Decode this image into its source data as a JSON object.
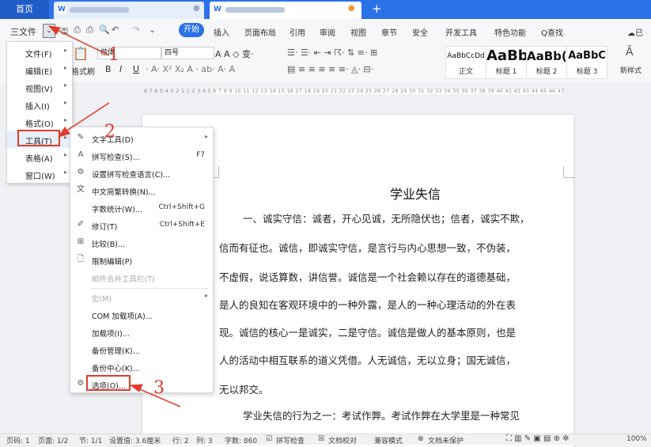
{
  "tabs": {
    "home": "首页",
    "new_tab": "+"
  },
  "menubar": {
    "file_menu": "三文件",
    "start_label": "开始",
    "items": [
      "插入",
      "页面布局",
      "引用",
      "审阅",
      "视图",
      "章节",
      "安全",
      "开发工具",
      "特色功能"
    ],
    "search": "Q查找"
  },
  "ribbon": {
    "format_painter": "格式刷",
    "font_name": "楷体",
    "font_size": "四号",
    "bold": "B",
    "italic": "I",
    "underline": "U",
    "styles": [
      {
        "preview": "AaBbCcDd",
        "name": "正文"
      },
      {
        "preview": "AaBb",
        "name": "标题 1"
      },
      {
        "preview": "AaBb(",
        "name": "标题 2"
      },
      {
        "preview": "AaBbC",
        "name": "标题 3"
      }
    ],
    "new_style": "新样式",
    "ruler_numbers": "8 7 6 5 4 3 2 1   1 2 3 4 5 6 7 8 9 10 11 12 13 14 15 16 17 18 19 20 21 22 23 24 25 26 27 28 29 30 31 32 33 34 35 36 37 38 39 40 41 42 43 44 45 46 47"
  },
  "main_menu": [
    {
      "label": "文件(F)"
    },
    {
      "label": "编辑(E)"
    },
    {
      "label": "视图(V)"
    },
    {
      "label": "插入(I)"
    },
    {
      "label": "格式(O)"
    },
    {
      "label": "工具(T)"
    },
    {
      "label": "表格(A)"
    },
    {
      "label": "窗口(W)"
    }
  ],
  "tools_submenu": [
    {
      "label": "文字工具(D)",
      "shortcut": "",
      "arrow": true,
      "icon": "✎"
    },
    {
      "label": "拼写检查(S)...",
      "shortcut": "F7",
      "icon": "A"
    },
    {
      "label": "设置拼写检查语言(C)...",
      "shortcut": "",
      "icon": "⚙"
    },
    {
      "label": "中文简繁转换(N)...",
      "shortcut": "",
      "icon": "文"
    },
    {
      "label": "字数统计(W)...",
      "shortcut": "Ctrl+Shift+G",
      "icon": ""
    },
    {
      "label": "修订(T)",
      "shortcut": "Ctrl+Shift+E",
      "icon": "✐"
    },
    {
      "label": "比较(B)...",
      "shortcut": "",
      "icon": "⊞"
    },
    {
      "label": "限制编辑(P)",
      "shortcut": "",
      "icon": "🗋"
    },
    {
      "label": "邮件合并工具栏(T)",
      "shortcut": "",
      "disabled": true,
      "icon": ""
    },
    {
      "label": "宏(M)",
      "shortcut": "",
      "arrow": true,
      "disabled": true,
      "icon": ""
    },
    {
      "label": "COM 加载项(A)...",
      "shortcut": "",
      "icon": ""
    },
    {
      "label": "加载项(I)...",
      "shortcut": "",
      "icon": ""
    },
    {
      "label": "备份管理(K)...",
      "shortcut": "",
      "icon": ""
    },
    {
      "label": "备份中心(K)...",
      "shortcut": "",
      "icon": ""
    },
    {
      "label": "选项(O)...",
      "shortcut": "",
      "icon": "⚙"
    }
  ],
  "document": {
    "title": "学业失信",
    "paragraphs": [
      "一、诚实守信：诚者，开心见诚，无所隐伏也；信者，诚实不欺，",
      "信而有征也。诚信，即诚实守信，是言行与内心思想一致，不伪装，",
      "不虚假，说话算数，讲信誉。诚信是一个社会赖以存在的道德基础，",
      "是人的良知在客观环境中的一种外露，是人的一种心理活动的外在表",
      "现。诚信的核心一是诚实，二是守信。诚信是做人的基本原则，也是",
      "人的活动中相互联系的道义凭借。人无诚信，无以立身；国无诚信，",
      "无以邦交。",
      "学业失信的行为之一：考试作弊。考试作弊在大学里是一种常见"
    ]
  },
  "annotations": {
    "n1": "1",
    "n2": "2",
    "n3": "3"
  },
  "statusbar": {
    "page": "页码: 1",
    "pages": "页面: 1/2",
    "section": "节: 1/1",
    "setting": "设置值: 3.6厘米",
    "row": "行: 2",
    "col": "列: 3",
    "words": "字数: 860",
    "spell": "拼写检查",
    "doc_check": "文档校对",
    "compat": "兼容模式",
    "unprotected": "文档未保护",
    "zoom": "100%"
  }
}
